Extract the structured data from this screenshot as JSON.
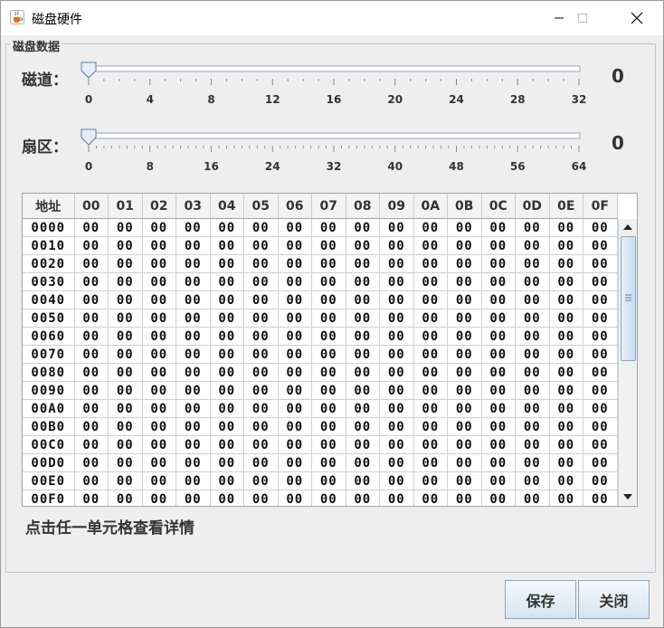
{
  "window": {
    "title": "磁盘硬件",
    "icon": "java-cup-icon"
  },
  "group": {
    "title": "磁盘数据"
  },
  "track": {
    "label": "磁道：",
    "value": "0",
    "ticks": [
      "0",
      "4",
      "8",
      "12",
      "16",
      "20",
      "24",
      "28",
      "32"
    ],
    "min": 0,
    "max": 32,
    "current": 0
  },
  "sector": {
    "label": "扇区：",
    "value": "0",
    "ticks": [
      "0",
      "8",
      "16",
      "24",
      "32",
      "40",
      "48",
      "56",
      "64"
    ],
    "min": 0,
    "max": 64,
    "current": 0
  },
  "table": {
    "headers": [
      "地址",
      "00",
      "01",
      "02",
      "03",
      "04",
      "05",
      "06",
      "07",
      "08",
      "09",
      "0A",
      "0B",
      "0C",
      "0D",
      "0E",
      "0F"
    ],
    "rows": [
      {
        "addr": "0000",
        "cells": [
          "00",
          "00",
          "00",
          "00",
          "00",
          "00",
          "00",
          "00",
          "00",
          "00",
          "00",
          "00",
          "00",
          "00",
          "00",
          "00"
        ]
      },
      {
        "addr": "0010",
        "cells": [
          "00",
          "00",
          "00",
          "00",
          "00",
          "00",
          "00",
          "00",
          "00",
          "00",
          "00",
          "00",
          "00",
          "00",
          "00",
          "00"
        ]
      },
      {
        "addr": "0020",
        "cells": [
          "00",
          "00",
          "00",
          "00",
          "00",
          "00",
          "00",
          "00",
          "00",
          "00",
          "00",
          "00",
          "00",
          "00",
          "00",
          "00"
        ]
      },
      {
        "addr": "0030",
        "cells": [
          "00",
          "00",
          "00",
          "00",
          "00",
          "00",
          "00",
          "00",
          "00",
          "00",
          "00",
          "00",
          "00",
          "00",
          "00",
          "00"
        ]
      },
      {
        "addr": "0040",
        "cells": [
          "00",
          "00",
          "00",
          "00",
          "00",
          "00",
          "00",
          "00",
          "00",
          "00",
          "00",
          "00",
          "00",
          "00",
          "00",
          "00"
        ]
      },
      {
        "addr": "0050",
        "cells": [
          "00",
          "00",
          "00",
          "00",
          "00",
          "00",
          "00",
          "00",
          "00",
          "00",
          "00",
          "00",
          "00",
          "00",
          "00",
          "00"
        ]
      },
      {
        "addr": "0060",
        "cells": [
          "00",
          "00",
          "00",
          "00",
          "00",
          "00",
          "00",
          "00",
          "00",
          "00",
          "00",
          "00",
          "00",
          "00",
          "00",
          "00"
        ]
      },
      {
        "addr": "0070",
        "cells": [
          "00",
          "00",
          "00",
          "00",
          "00",
          "00",
          "00",
          "00",
          "00",
          "00",
          "00",
          "00",
          "00",
          "00",
          "00",
          "00"
        ]
      },
      {
        "addr": "0080",
        "cells": [
          "00",
          "00",
          "00",
          "00",
          "00",
          "00",
          "00",
          "00",
          "00",
          "00",
          "00",
          "00",
          "00",
          "00",
          "00",
          "00"
        ]
      },
      {
        "addr": "0090",
        "cells": [
          "00",
          "00",
          "00",
          "00",
          "00",
          "00",
          "00",
          "00",
          "00",
          "00",
          "00",
          "00",
          "00",
          "00",
          "00",
          "00"
        ]
      },
      {
        "addr": "00A0",
        "cells": [
          "00",
          "00",
          "00",
          "00",
          "00",
          "00",
          "00",
          "00",
          "00",
          "00",
          "00",
          "00",
          "00",
          "00",
          "00",
          "00"
        ]
      },
      {
        "addr": "00B0",
        "cells": [
          "00",
          "00",
          "00",
          "00",
          "00",
          "00",
          "00",
          "00",
          "00",
          "00",
          "00",
          "00",
          "00",
          "00",
          "00",
          "00"
        ]
      },
      {
        "addr": "00C0",
        "cells": [
          "00",
          "00",
          "00",
          "00",
          "00",
          "00",
          "00",
          "00",
          "00",
          "00",
          "00",
          "00",
          "00",
          "00",
          "00",
          "00"
        ]
      },
      {
        "addr": "00D0",
        "cells": [
          "00",
          "00",
          "00",
          "00",
          "00",
          "00",
          "00",
          "00",
          "00",
          "00",
          "00",
          "00",
          "00",
          "00",
          "00",
          "00"
        ]
      },
      {
        "addr": "00E0",
        "cells": [
          "00",
          "00",
          "00",
          "00",
          "00",
          "00",
          "00",
          "00",
          "00",
          "00",
          "00",
          "00",
          "00",
          "00",
          "00",
          "00"
        ]
      },
      {
        "addr": "00F0",
        "cells": [
          "00",
          "00",
          "00",
          "00",
          "00",
          "00",
          "00",
          "00",
          "00",
          "00",
          "00",
          "00",
          "00",
          "00",
          "00",
          "00"
        ]
      }
    ]
  },
  "hint": "点击任一单元格查看详情",
  "buttons": {
    "save": "保存",
    "close": "关闭"
  }
}
